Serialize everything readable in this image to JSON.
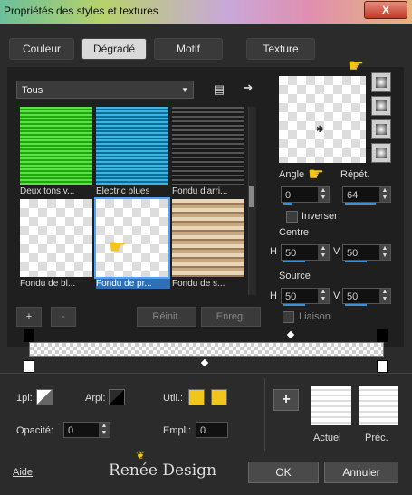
{
  "window": {
    "title": "Propriétés des styles et textures",
    "close": "X"
  },
  "tabs": [
    {
      "label": "Couleur",
      "active": false
    },
    {
      "label": "Dégradé",
      "active": true
    },
    {
      "label": "Motif",
      "active": false
    },
    {
      "label": "Texture",
      "active": false
    }
  ],
  "gallery": {
    "category": "Tous",
    "items": [
      {
        "label": "Deux tons v...",
        "color": "#35c21c"
      },
      {
        "label": "Electric blues",
        "color": "#1b8fbf"
      },
      {
        "label": "Fondu d'arri...",
        "color": "#2a2a2a"
      },
      {
        "label": "Fondu de bl...",
        "color": "#ffffff"
      },
      {
        "label": "Fondu de pr...",
        "color": "#ffffff"
      },
      {
        "label": "Fondu de s...",
        "color": "#c8a88a"
      }
    ],
    "add": "+",
    "remove": "-",
    "reset": "Réinit.",
    "save": "Enreg."
  },
  "params": {
    "angle_label": "Angle",
    "angle_value": "0",
    "repeat_label": "Répét.",
    "repeat_value": "64",
    "invert_label": "Inverser",
    "center_label": "Centre",
    "center_h_label": "H",
    "center_h": "50",
    "center_v_label": "V",
    "center_v": "50",
    "source_label": "Source",
    "source_h_label": "H",
    "source_h": "50",
    "source_v_label": "V",
    "source_v": "50",
    "link_label": "Liaison"
  },
  "bottom": {
    "opacity_stop_label": "1pl:",
    "arpl_label": "Arpl:",
    "util_label": "Util.:",
    "opacity_label": "Opacité:",
    "opacity_value": "0",
    "empl_label": "Empl.:",
    "empl_value": "0",
    "accent": "#f2c51c",
    "current_label": "Actuel",
    "previous_label": "Préc.",
    "watermark": "Renée Design",
    "help": "Aide",
    "ok": "OK",
    "cancel": "Annuler"
  }
}
